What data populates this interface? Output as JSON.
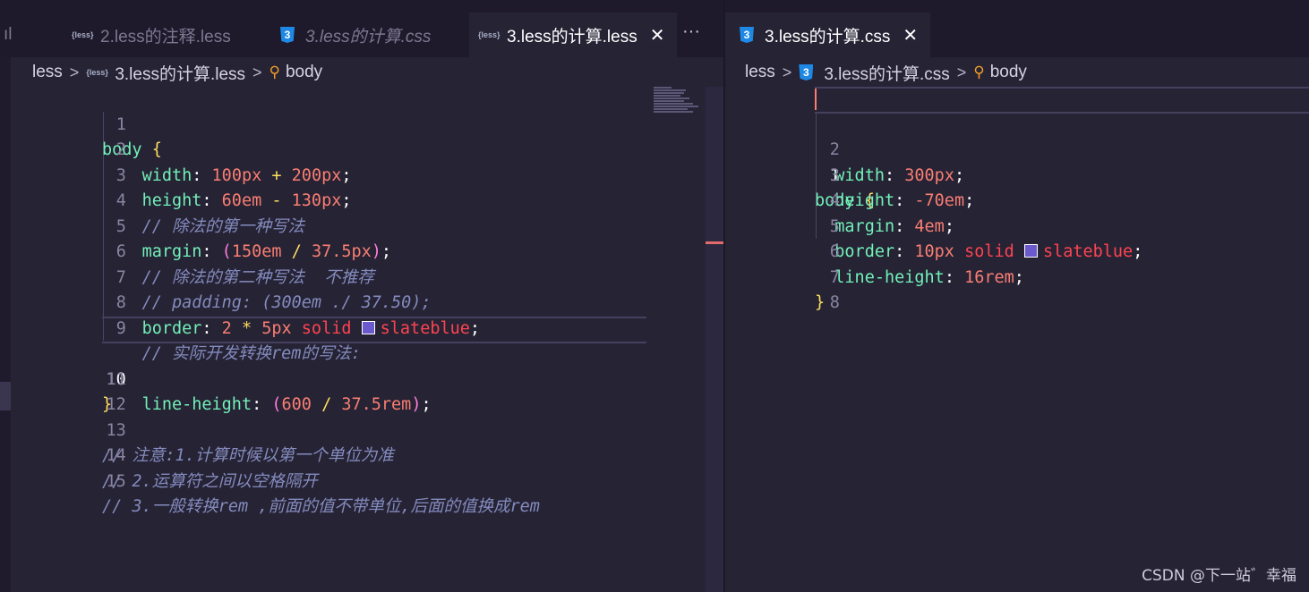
{
  "left": {
    "tabs": [
      {
        "name": "2.less的注释.less",
        "type": "less",
        "active": false,
        "italic": false
      },
      {
        "name": "3.less的计算.css",
        "type": "css",
        "active": false,
        "italic": true
      },
      {
        "name": "3.less的计算.less",
        "type": "less",
        "active": true,
        "italic": false,
        "close": "✕"
      }
    ],
    "tab_more": "···",
    "tab_fragment": "ıl",
    "breadcrumb": {
      "folder": "less",
      "file": "3.less的计算.less",
      "symbol": "body",
      "file_icon_text": "{less}"
    },
    "current_line": "10",
    "line_numbers": [
      "1",
      "2",
      "3",
      "4",
      "5",
      "6",
      "7",
      "8",
      "9",
      "10",
      "11",
      "12",
      "13",
      "14",
      "15"
    ],
    "code": {
      "l1": {
        "sel": "body",
        "brace": "{"
      },
      "l2": {
        "prop": "width",
        "colon": ":",
        "v1": "100px",
        "op": "+",
        "v2": "200px",
        "semi": ";"
      },
      "l3": {
        "prop": "height",
        "colon": ":",
        "v1": "60em",
        "op": "-",
        "v2": "130px",
        "semi": ";"
      },
      "l4": {
        "comment": "// 除法的第一种写法"
      },
      "l5": {
        "prop": "margin",
        "colon": ":",
        "p1": "(",
        "v1": "150em",
        "op": "/",
        "v2": "37.5px",
        "p2": ")",
        "semi": ";"
      },
      "l6": {
        "comment": "// 除法的第二种写法  不推荐"
      },
      "l7": {
        "comment": "// padding: (300em ./ 37.50);"
      },
      "l8": {
        "prop": "border",
        "colon": ":",
        "v1": "2",
        "op": "*",
        "v2": "5px",
        "kw": "solid",
        "color": "slateblue",
        "semi": ";"
      },
      "l9": {
        "comment": "// 实际开发转换rem的写法:"
      },
      "l10": {
        "prop": "line-height",
        "colon": ":",
        "p1": "(",
        "v1": "600",
        "op": "/",
        "v2": "37.5rem",
        "p2": ")",
        "semi": ";"
      },
      "l11": {
        "brace": "}"
      },
      "l13": {
        "comment": "// 注意:1.计算时候以第一个单位为准"
      },
      "l14": {
        "comment": "// 2.运算符之间以空格隔开"
      },
      "l15": {
        "comment": "// 3.一般转换rem ,前面的值不带单位,后面的值换成rem"
      }
    }
  },
  "right": {
    "tab": {
      "name": "3.less的计算.css",
      "type": "css",
      "close": "✕"
    },
    "breadcrumb": {
      "folder": "less",
      "file": "3.less的计算.css",
      "symbol": "body",
      "file_icon_text": "3"
    },
    "current_line": "1",
    "line_numbers": [
      "1",
      "2",
      "3",
      "4",
      "5",
      "6",
      "7",
      "8"
    ],
    "code": {
      "l1": {
        "sel": "body",
        "brace": "{"
      },
      "l2": {
        "prop": "width",
        "colon": ":",
        "v1": "300px",
        "semi": ";"
      },
      "l3": {
        "prop": "height",
        "colon": ":",
        "v1": "-70em",
        "semi": ";"
      },
      "l4": {
        "prop": "margin",
        "colon": ":",
        "v1": "4em",
        "semi": ";"
      },
      "l5": {
        "prop": "border",
        "colon": ":",
        "v1": "10px",
        "kw": "solid",
        "color": "slateblue",
        "semi": ";"
      },
      "l6": {
        "prop": "line-height",
        "colon": ":",
        "v1": "16rem",
        "semi": ";"
      },
      "l7": {
        "brace": "}"
      }
    }
  },
  "watermark": "CSDN @下一站゛幸福",
  "colors": {
    "background": "#262335",
    "tabbar": "#1e1a2b",
    "selector": "#72f1b8",
    "number": "#f97e72",
    "keyword": "#fe4450",
    "brace": "#fede5d",
    "paren": "#ff7edb",
    "comment": "#848bbd",
    "swatch": "#6a5acd",
    "scrollbar_marker": "#e36a6a"
  }
}
